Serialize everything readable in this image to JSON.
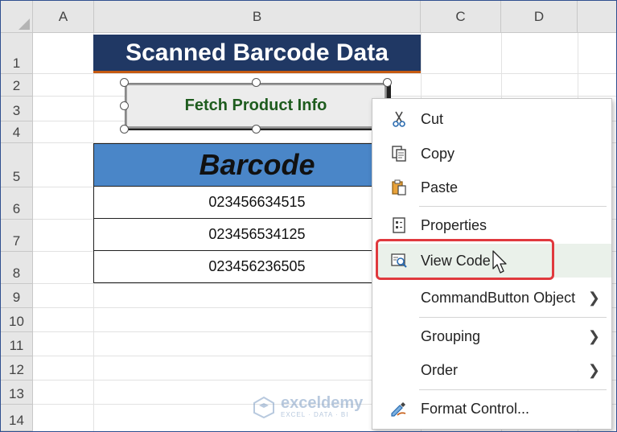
{
  "sheet": {
    "columns": [
      "A",
      "B",
      "C",
      "D"
    ],
    "rows": [
      "1",
      "2",
      "3",
      "4",
      "5",
      "6",
      "7",
      "8",
      "9",
      "10",
      "11",
      "12",
      "13",
      "14"
    ],
    "title": "Scanned Barcode Data",
    "button_label": "Fetch Product Info",
    "table": {
      "header": "Barcode",
      "values": [
        "023456634515",
        "023456534125",
        "023456236505"
      ]
    }
  },
  "context_menu": {
    "items": [
      {
        "label": "Cut",
        "icon": "scissors-icon"
      },
      {
        "label": "Copy",
        "icon": "copy-icon"
      },
      {
        "label": "Paste",
        "icon": "paste-icon"
      },
      {
        "label": "Properties",
        "icon": "properties-icon"
      },
      {
        "label": "View Code",
        "icon": "view-code-icon"
      },
      {
        "label": "CommandButton Object",
        "icon": "",
        "submenu": true
      },
      {
        "label": "Grouping",
        "icon": "",
        "submenu": true
      },
      {
        "label": "Order",
        "icon": "",
        "submenu": true
      },
      {
        "label": "Format Control...",
        "icon": "format-control-icon"
      }
    ],
    "highlighted": "View Code"
  },
  "watermark": {
    "name": "exceldemy",
    "tagline": "EXCEL · DATA · BI"
  },
  "colors": {
    "title_bg": "#203864",
    "table_header_bg": "#4a86c8",
    "button_text": "#1e5c1e",
    "highlight_border": "#e0393e"
  }
}
